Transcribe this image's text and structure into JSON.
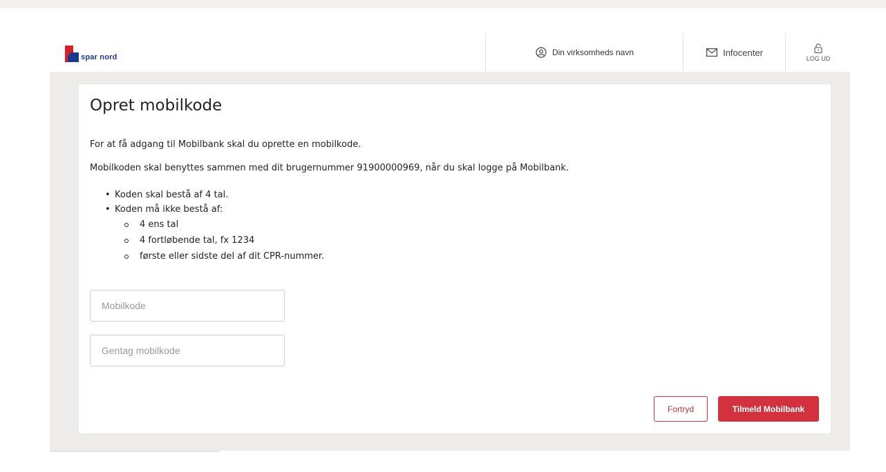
{
  "header": {
    "logo_text": "spar nord",
    "company_label": "Din virksomheds navn",
    "infocenter_label": "Infocenter",
    "logout_label": "LOG UD"
  },
  "page": {
    "title": "Opret mobilkode",
    "intro": "For at få adgang til Mobilbank skal du oprette en mobilkode.",
    "usage": "Mobilkoden skal benyttes sammen med dit brugernummer 91900000969, når du skal logge på Mobilbank.",
    "rules": [
      "Koden skal bestå af 4 tal.",
      "Koden må ikke bestå af:"
    ],
    "subrules": [
      "4 ens tal",
      "4 fortløbende tal, fx 1234",
      "første eller sidste del af dit CPR-nummer."
    ]
  },
  "form": {
    "code_placeholder": "Mobilkode",
    "code_value": "",
    "repeat_placeholder": "Gentag mobilkode",
    "repeat_value": ""
  },
  "actions": {
    "cancel_label": "Fortryd",
    "submit_label": "Tilmeld Mobilbank"
  },
  "colors": {
    "brand_red": "#d2323e",
    "brand_blue": "#1b3a8a"
  }
}
